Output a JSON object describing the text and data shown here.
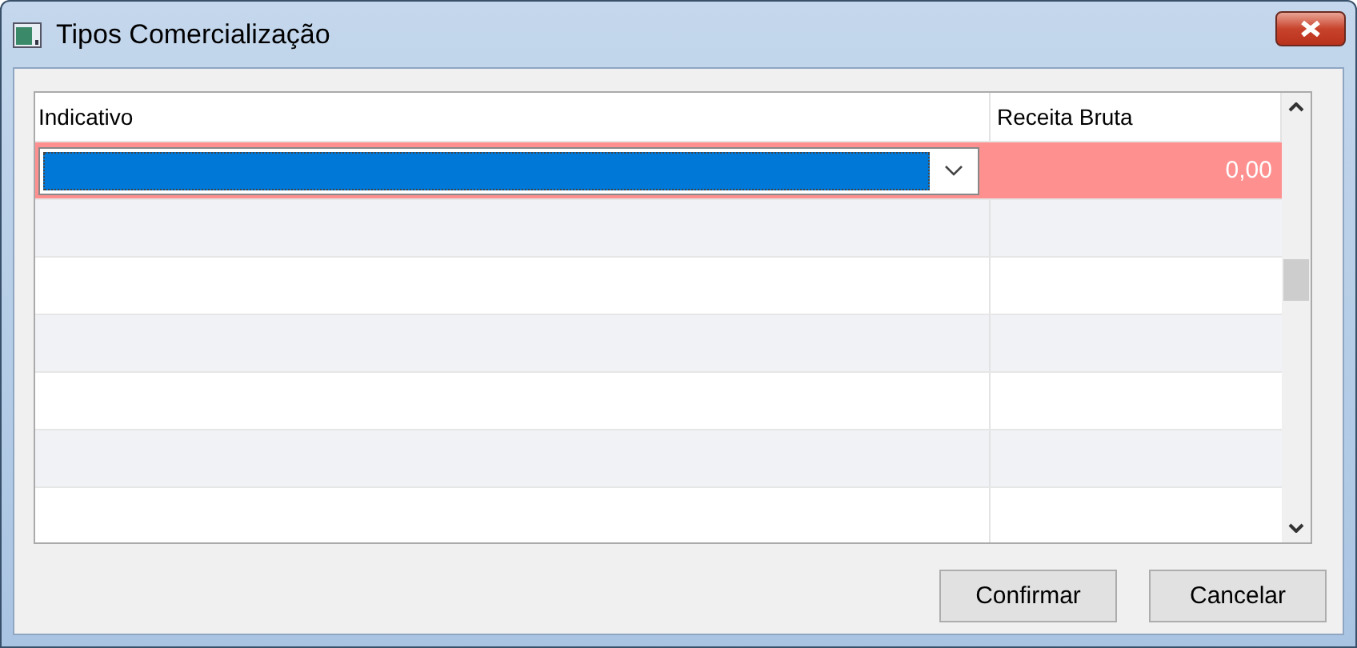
{
  "window": {
    "title": "Tipos Comercialização"
  },
  "table": {
    "columns": [
      "Indicativo",
      "Receita Bruta"
    ],
    "rows": [
      {
        "selected": true,
        "invalid": true,
        "receita_bruta": "0,00"
      }
    ]
  },
  "buttons": [
    "Confirmar",
    "Cancelar"
  ]
}
